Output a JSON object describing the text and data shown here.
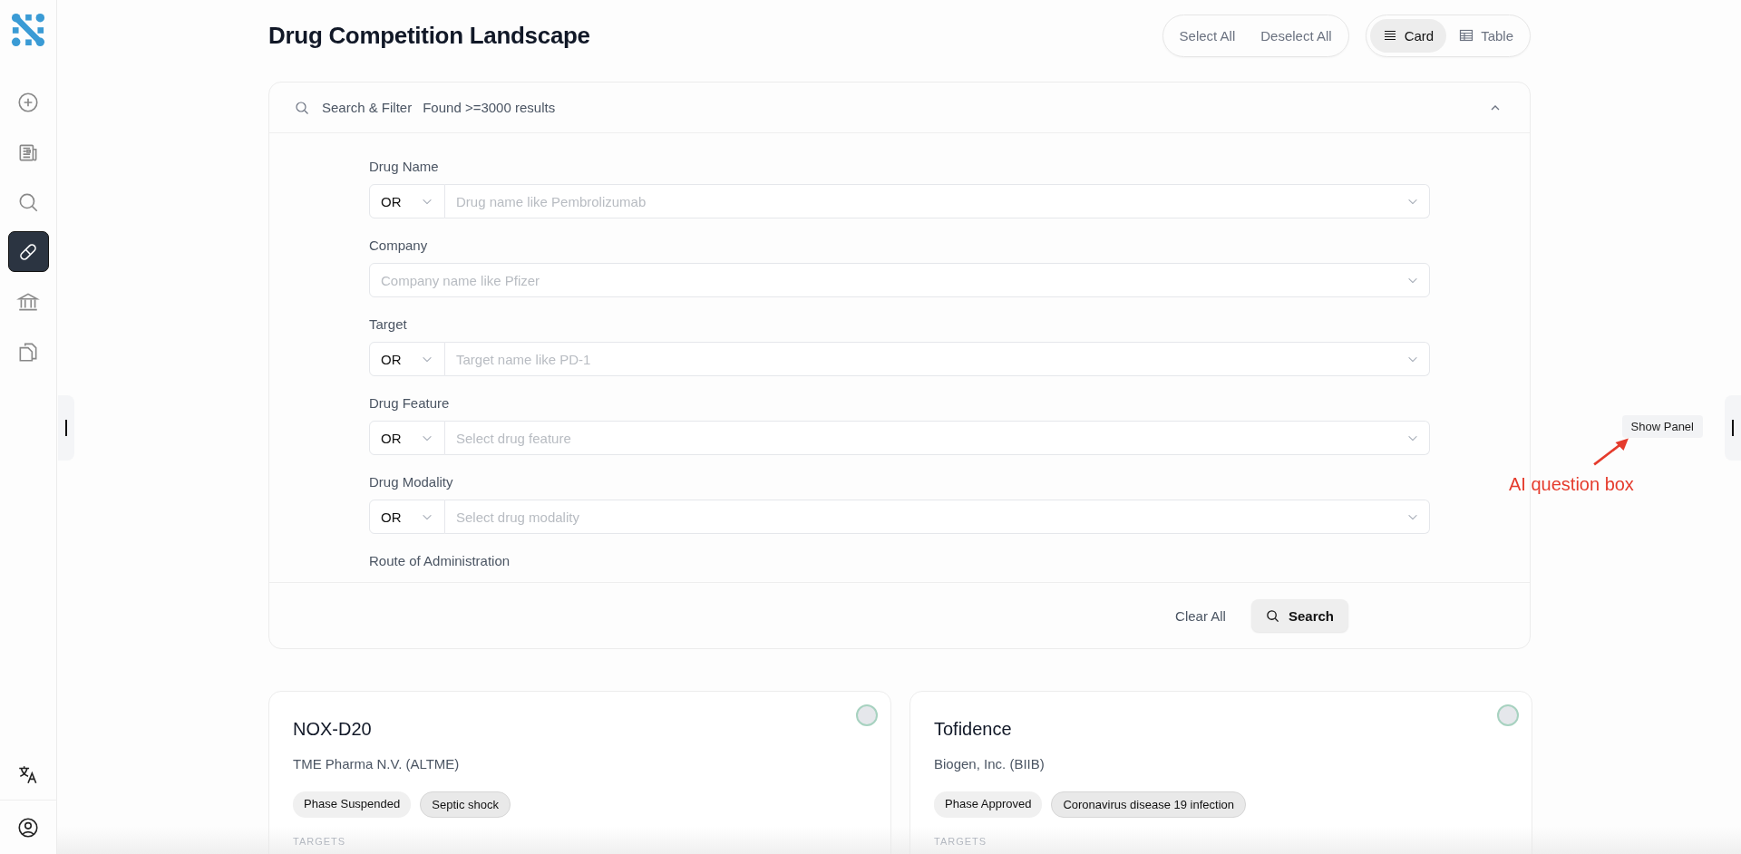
{
  "sidebar": {
    "items": [
      {
        "kind": "plus",
        "selected": false
      },
      {
        "kind": "news",
        "selected": false
      },
      {
        "kind": "search",
        "selected": false
      },
      {
        "kind": "pill",
        "selected": true
      },
      {
        "kind": "bank",
        "selected": false
      },
      {
        "kind": "files",
        "selected": false
      }
    ],
    "bottom_items": [
      {
        "kind": "translate"
      },
      {
        "kind": "user"
      }
    ]
  },
  "header": {
    "title": "Drug Competition Landscape",
    "selection_buttons": [
      "Select All",
      "Deselect All"
    ],
    "view_toggle": [
      {
        "label": "Card",
        "kind": "list",
        "selected": true
      },
      {
        "label": "Table",
        "kind": "table",
        "selected": false
      }
    ]
  },
  "filter": {
    "title": "Search & Filter",
    "result_count": "Found >=3000 results",
    "expanded": true,
    "fields": [
      {
        "label": "Drug Name",
        "kind": "or-select",
        "operator": "OR",
        "placeholder": "Drug name like Pembrolizumab"
      },
      {
        "label": "Company",
        "kind": "select",
        "placeholder": "Company name like Pfizer"
      },
      {
        "label": "Target",
        "kind": "or-select",
        "operator": "OR",
        "placeholder": "Target name like PD-1"
      },
      {
        "label": "Drug Feature",
        "kind": "or-select",
        "operator": "OR",
        "placeholder": "Select drug feature"
      },
      {
        "label": "Drug Modality",
        "kind": "or-select",
        "operator": "OR",
        "placeholder": "Select drug modality"
      },
      {
        "label": "Route of Administration",
        "kind": "label-only"
      }
    ],
    "buttons": [
      {
        "label": "Clear All",
        "kind": "plain"
      },
      {
        "label": "Search",
        "kind": "search"
      }
    ]
  },
  "panel_button": "Show Panel",
  "annotation": "AI question box",
  "cards": [
    {
      "name": "NOX-D20",
      "company": "TME Pharma N.V. (ALTME)",
      "selected": false,
      "tags": [
        {
          "label": "Phase Suspended",
          "kind": "phase"
        },
        {
          "label": "Septic shock",
          "kind": "indication"
        }
      ],
      "section": "TARGETS"
    },
    {
      "name": "Tofidence",
      "company": "Biogen, Inc. (BIIB)",
      "selected": false,
      "tags": [
        {
          "label": "Phase Approved",
          "kind": "phase"
        },
        {
          "label": "Coronavirus disease 19 infection",
          "kind": "indication"
        }
      ],
      "section": "TARGETS"
    }
  ]
}
